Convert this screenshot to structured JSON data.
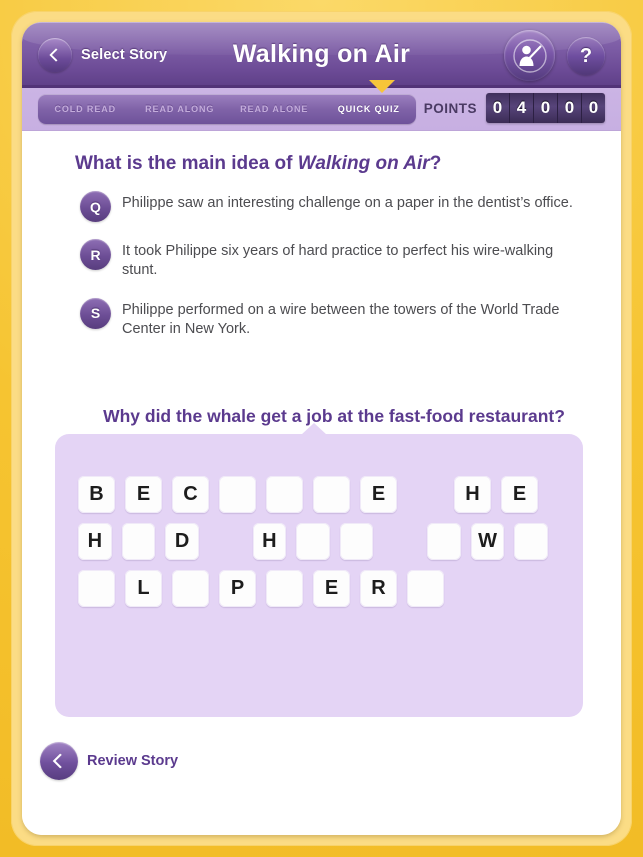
{
  "header": {
    "back_label": "Select Story",
    "title": "Walking on Air",
    "help_label": "?"
  },
  "tabs": [
    {
      "label": "COLD READ",
      "active": false
    },
    {
      "label": "READ ALONG",
      "active": false
    },
    {
      "label": "READ ALONE",
      "active": false
    },
    {
      "label": "QUICK QUIZ",
      "active": true
    }
  ],
  "points": {
    "label": "POINTS",
    "digits": [
      "0",
      "4",
      "0",
      "0",
      "0"
    ]
  },
  "main_idea": {
    "question_prefix": "What is the main idea of ",
    "question_title": "Walking on Air",
    "question_suffix": "?",
    "answers": [
      {
        "badge": "Q",
        "text": "Philippe saw an interesting challenge on a paper in the dentist’s office."
      },
      {
        "badge": "R",
        "text": "It took Philippe six years of hard practice to perfect his wire-walking stunt."
      },
      {
        "badge": "S",
        "text": "Philippe performed on a wire between the towers of the World Trade Center in New York."
      }
    ]
  },
  "riddle": {
    "question": "Why did the whale get a job at the fast-food restaurant?",
    "rows": [
      [
        "B",
        "E",
        "C",
        "",
        "",
        "",
        "E",
        null,
        "H",
        "E"
      ],
      [
        "H",
        "",
        "D",
        null,
        "H",
        "",
        "",
        null,
        "",
        "W",
        ""
      ],
      [
        "",
        "L",
        "",
        "P",
        "",
        "E",
        "R",
        ""
      ]
    ]
  },
  "footer": {
    "review_label": "Review Story"
  },
  "colors": {
    "frame": "#f6c431",
    "purple_dark": "#5b3a8e",
    "panel": "#e4d4f5",
    "tab_strip": "#cbb4e4",
    "pointer": "#f7c53a"
  }
}
